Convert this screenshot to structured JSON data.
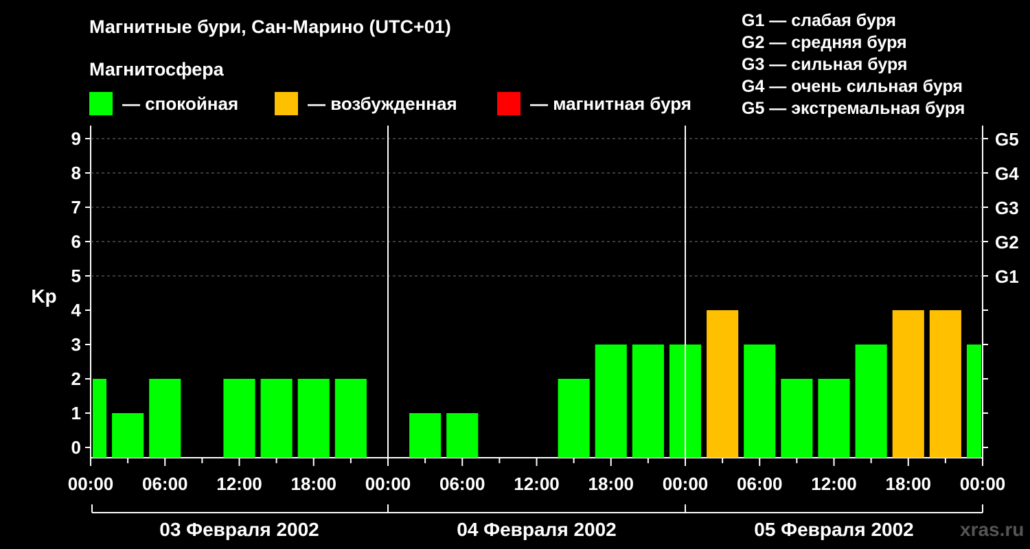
{
  "title": "Магнитные бури, Сан-Марино (UTC+01)",
  "subtitle": "Магнитосфера",
  "legend": [
    {
      "label": "— спокойная",
      "color": "#00ff00"
    },
    {
      "label": "— возбужденная",
      "color": "#ffc000"
    },
    {
      "label": "— магнитная буря",
      "color": "#ff0000"
    }
  ],
  "g_scale": [
    "G1 — слабая буря",
    "G2 — средняя буря",
    "G3 — сильная буря",
    "G4 — очень сильная буря",
    "G5 — экстремальная буря"
  ],
  "watermark": "xras.ru",
  "chart_data": {
    "type": "bar",
    "ylabel": "Kp",
    "ylim": [
      0,
      9
    ],
    "yticks": [
      0,
      1,
      2,
      3,
      4,
      5,
      6,
      7,
      8,
      9
    ],
    "right_ticks": [
      {
        "value": 5,
        "label": "G1"
      },
      {
        "value": 6,
        "label": "G2"
      },
      {
        "value": 7,
        "label": "G3"
      },
      {
        "value": 8,
        "label": "G4"
      },
      {
        "value": 9,
        "label": "G5"
      }
    ],
    "grid": "dashed horizontal at 5–9",
    "x_tick_labels": [
      "00:00",
      "06:00",
      "12:00",
      "18:00",
      "00:00",
      "06:00",
      "12:00",
      "18:00",
      "00:00",
      "06:00",
      "12:00",
      "18:00",
      "00:00"
    ],
    "days": [
      "03 Февраля 2002",
      "04 Февраля 2002",
      "05 Февраля 2002"
    ],
    "interval_hours": 3,
    "bar_colors": {
      "quiet": "#00ff00",
      "active": "#ffc000",
      "storm": "#ff0000"
    },
    "values": [
      2,
      1,
      2,
      0,
      2,
      2,
      2,
      2,
      0,
      1,
      1,
      0,
      0,
      2,
      3,
      3,
      3,
      4,
      3,
      2,
      2,
      3,
      4,
      4,
      3
    ]
  }
}
